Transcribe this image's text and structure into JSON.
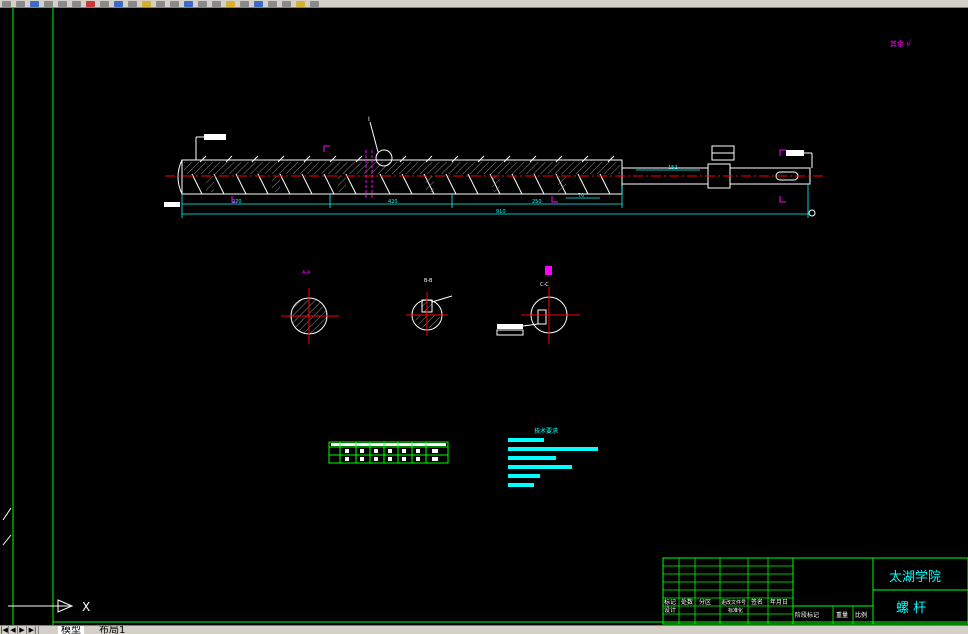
{
  "colors": {
    "background": "#000000",
    "frame": "#00ff00",
    "dimension": "#00ffff",
    "geometry": "#ffffff",
    "hatch": "#7f7f7f",
    "centerline": "#ff0000",
    "annotation": "#ff00ff",
    "title_text": "#00ffff",
    "toolbar": "#d4d0c8"
  },
  "drawing": {
    "roughness_note": "其余",
    "roughness_symbol": "√",
    "dimensions": {
      "d_270": "270",
      "d_420": "420",
      "d_250": "250",
      "d_910": "910",
      "d_70": "70",
      "d_152": "152"
    },
    "section_labels": {
      "a": "A-A",
      "b": "B-B",
      "c": "C-C"
    },
    "callout_i": "I",
    "tech_req_title": "技术要求",
    "param_table": {
      "headers": [
        "",
        "",
        "",
        "",
        "",
        "",
        "",
        ""
      ],
      "rows": [
        [
          "",
          "",
          "",
          "",
          "",
          "",
          "",
          ""
        ],
        [
          "",
          "",
          "",
          "",
          "",
          "",
          "",
          ""
        ]
      ]
    }
  },
  "title_block": {
    "school": "太湖学院",
    "part_name": "螺 杆",
    "labels": {
      "mark": "标记",
      "count": "处数",
      "zone": "分区",
      "change_doc": "更改文件号",
      "sign": "签名",
      "date": "年月日",
      "design": "设计",
      "standardize": "标准化",
      "stage_mark": "阶段标记",
      "weight": "重量",
      "scale": "比例"
    }
  },
  "layout_tabs": {
    "model": "模型",
    "layout1": "布局1"
  },
  "ucs": {
    "x_label": "X"
  }
}
